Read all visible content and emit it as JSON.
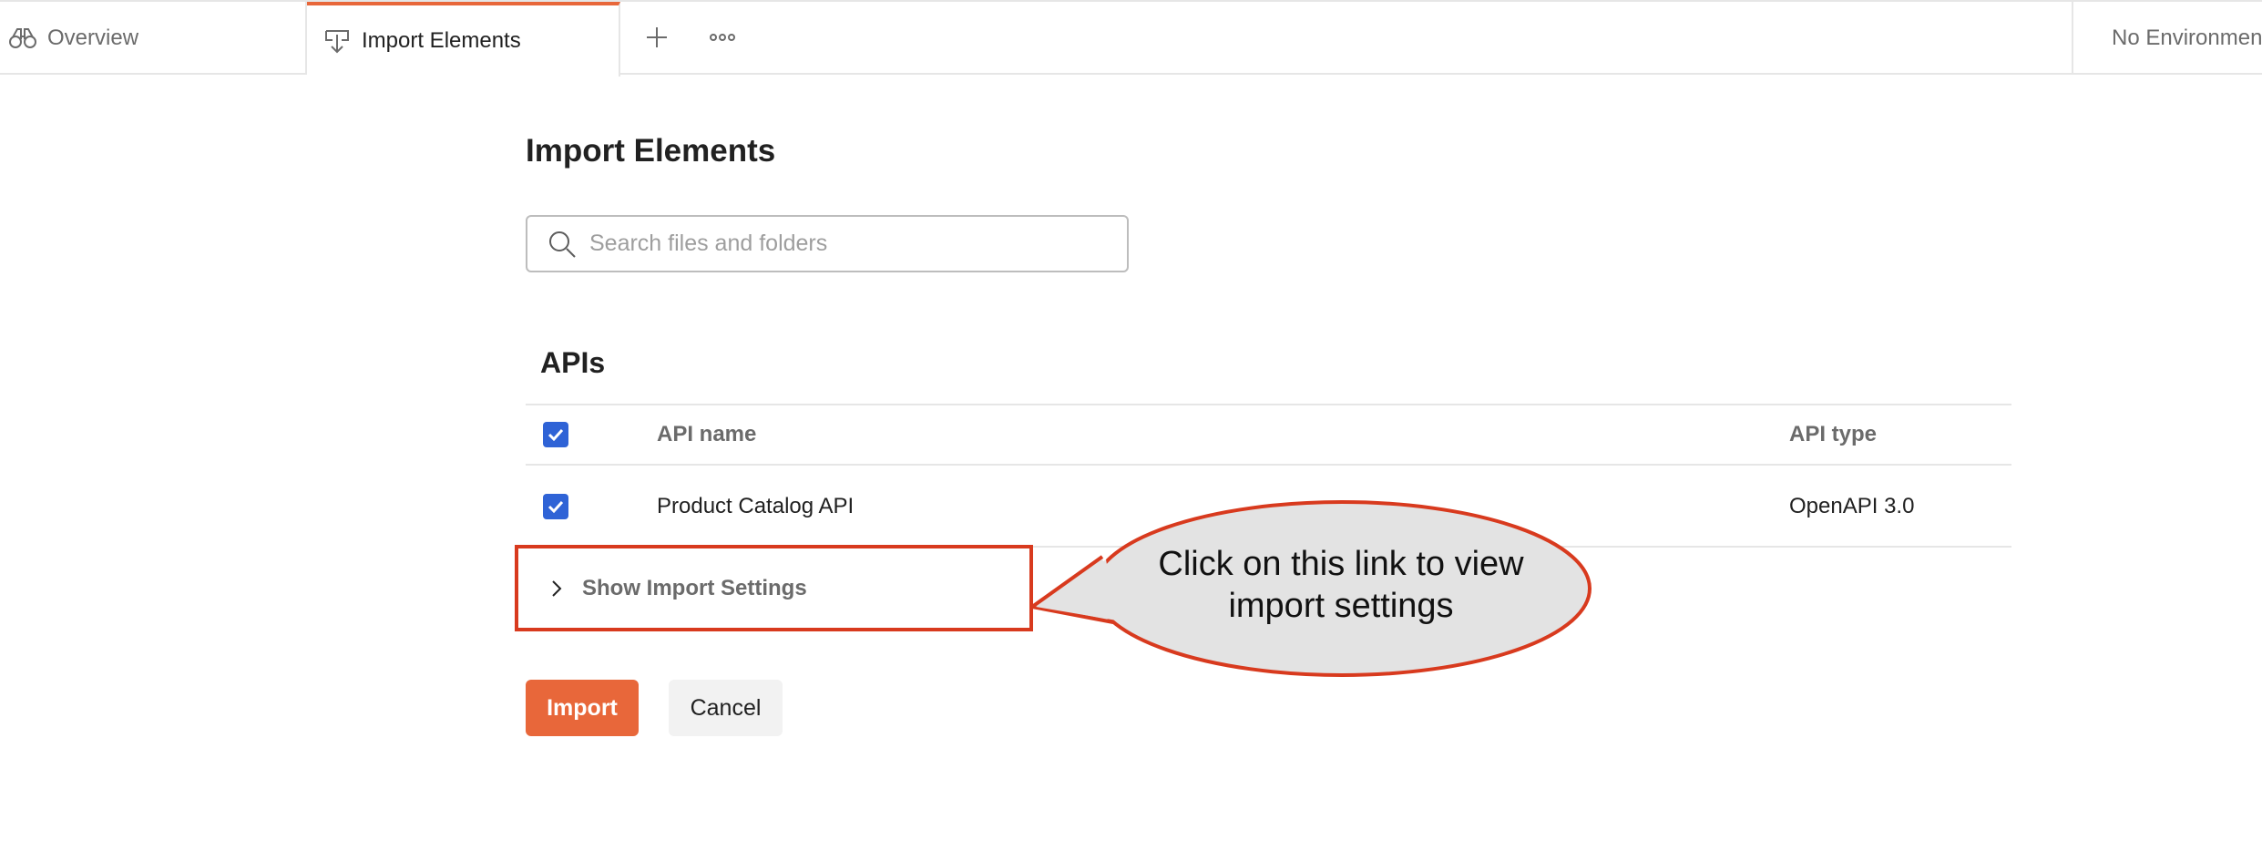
{
  "tabs": {
    "overview_label": "Overview",
    "import_label": "Import Elements"
  },
  "environment": {
    "label": "No Environment"
  },
  "page": {
    "title": "Import Elements"
  },
  "search": {
    "placeholder": "Search files and folders",
    "value": ""
  },
  "apis_section": {
    "title": "APIs",
    "columns": {
      "name": "API name",
      "type": "API type"
    },
    "rows": [
      {
        "name": "Product Catalog API",
        "type": "OpenAPI 3.0",
        "checked": true
      }
    ],
    "select_all_checked": true
  },
  "import_settings": {
    "toggle_label": "Show Import Settings"
  },
  "callout": {
    "line1": "Click on this link to view",
    "line2": "import settings"
  },
  "actions": {
    "import_label": "Import",
    "cancel_label": "Cancel"
  },
  "colors": {
    "accent": "#e8673a",
    "checkbox": "#2f63d6",
    "annotation_border": "#d83a1e"
  },
  "icons": {
    "overview": "binoculars-icon",
    "import": "import-tray-icon",
    "new_tab": "plus-icon",
    "more": "ellipsis-icon",
    "search": "search-icon",
    "expand": "chevron-right-icon",
    "check": "checkmark-icon"
  }
}
